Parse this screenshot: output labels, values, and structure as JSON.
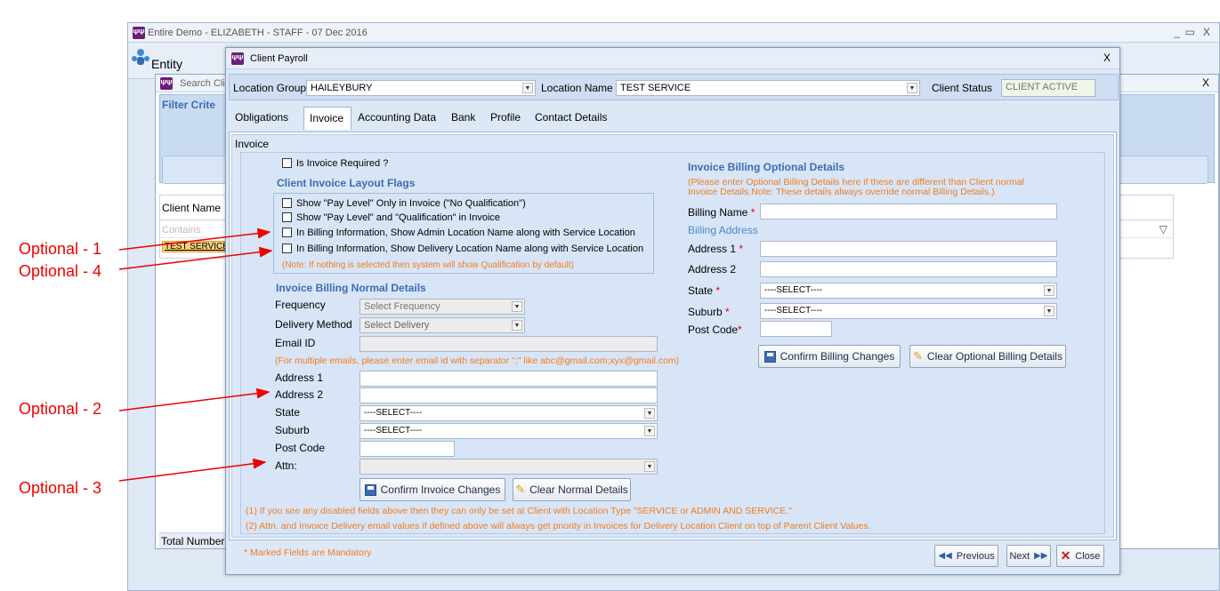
{
  "app": {
    "title": "Entire Demo - ELIZABETH - STAFF - 07 Dec 2016",
    "entity_label": "Entity",
    "window_controls": [
      "_",
      "▭",
      "X"
    ]
  },
  "search_panel": {
    "title": "Search Clie",
    "filter_label": "Filter Crite",
    "client_name_header": "Client Name",
    "contains_placeholder": "Contains:",
    "row_value": "TEST SERVICE",
    "total_label": "Total Number"
  },
  "dialog": {
    "title": "Client Payroll",
    "close": "X",
    "location_group_label": "Location Group",
    "location_group_value": "HAILEYBURY",
    "location_name_label": "Location Name",
    "location_name_value": "TEST SERVICE",
    "client_status_label": "Client Status",
    "client_status_value": "CLIENT ACTIVE",
    "tabs": [
      "Obligations",
      "Invoice",
      "Accounting Data",
      "Bank",
      "Profile",
      "Contact Details"
    ],
    "active_tab": "Invoice",
    "section_title": "Invoice",
    "invoice_required_label": "Is Invoice Required ?",
    "layout_flags_title": "Client Invoice Layout Flags",
    "flags": [
      "Show \"Pay Level\" Only in Invoice (\"No Qualification\")",
      "Show \"Pay Level\" and \"Qualification\" in Invoice",
      "In Billing Information, Show Admin Location Name along with Service Location",
      "In Billing Information, Show Delivery Location Name along with Service Location"
    ],
    "flags_note": "(Note: If nothing is selected then system will show Qualification by default)",
    "normal_title": "Invoice Billing Normal Details",
    "frequency_label": "Frequency",
    "frequency_value": "Select Frequency",
    "delivery_label": "Delivery Method",
    "delivery_value": "Select Delivery",
    "email_label": "Email ID",
    "email_note": "(For multiple emails, please enter email id with separator \";\" like abc@gmail.com;xyx@gmail.com)",
    "address1_label": "Address 1",
    "address2_label": "Address 2",
    "state_label": "State",
    "state_value": "----SELECT----",
    "suburb_label": "Suburb",
    "suburb_value": "----SELECT----",
    "postcode_label": "Post Code",
    "attn_label": "Attn:",
    "confirm_invoice": "Confirm Invoice Changes",
    "clear_normal": "Clear Normal Details",
    "optional_title": "Invoice Billing Optional Details",
    "optional_note1": "(Please enter Optional Billing Details here if these are different than Client normal",
    "optional_note2": "Invoice Details.Note: These details always override normal Billing Details.)",
    "billing_name_label": "Billing Name",
    "billing_address_label": "Billing Address",
    "opt_address1_label": "Address 1",
    "opt_address2_label": "Address 2",
    "opt_state_label": "State",
    "opt_state_value": "----SELECT----",
    "opt_suburb_label": "Suburb",
    "opt_suburb_value": "----SELECT----",
    "opt_postcode_label": "Post Code",
    "required_mark": "*",
    "confirm_billing": "Confirm Billing Changes",
    "clear_optional": "Clear Optional Billing Details",
    "footnote1": "(1) If you see any disabled fields above then they can only be set at Client with Location Type \"SERVICE or ADMIN AND SERVICE.\"",
    "footnote2": "(2) Attn. and Invoice Delivery email values if defined above will always get priority in Invoices for Delivery Location Client on top of Parent Client Values.",
    "mandatory_note": "* Marked Fields are Mandatory",
    "previous": "Previous",
    "next": "Next",
    "close_btn": "Close"
  },
  "annotations": [
    "Optional - 1",
    "Optional - 4",
    "Optional - 2",
    "Optional - 3"
  ],
  "colors": {
    "annotation": "#e00000",
    "heading_blue": "#3a6db5",
    "note_orange": "#f07c20"
  }
}
